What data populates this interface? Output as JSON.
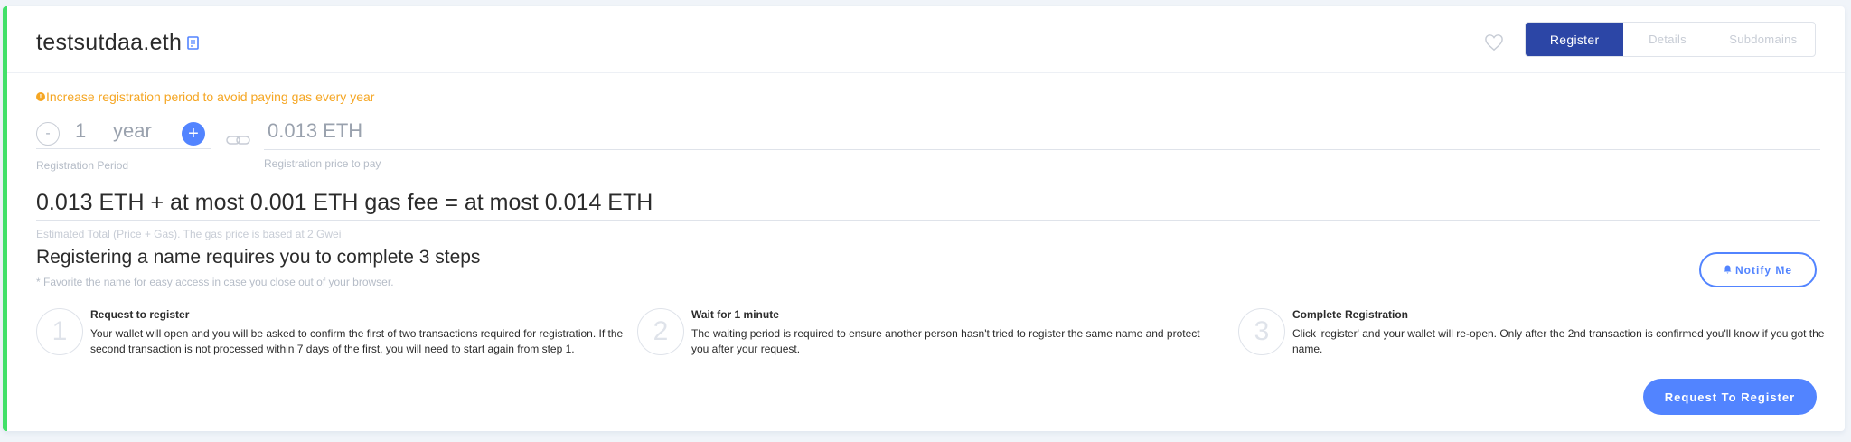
{
  "header": {
    "domain_name": "testsutdaa.eth",
    "tabs": [
      {
        "label": "Register",
        "active": true
      },
      {
        "label": "Details",
        "active": false
      },
      {
        "label": "Subdomains",
        "active": false
      }
    ],
    "icons": {
      "copy": "copy-icon",
      "favorite": "heart-icon"
    }
  },
  "registration": {
    "warning": "Increase registration period to avoid paying gas every year",
    "minus_label": "-",
    "years": "1",
    "year_unit": "year",
    "plus_label": "+",
    "period_label": "Registration Period",
    "price": "0.013 ETH",
    "price_label": "Registration price to pay",
    "total": "0.013 ETH + at most 0.001 ETH gas fee = at most 0.014 ETH",
    "total_label": "Estimated Total (Price + Gas). The gas price is based at 2 Gwei"
  },
  "steps": {
    "title": "Registering a name requires you to complete 3 steps",
    "note": "* Favorite the name for easy access in case you close out of your browser.",
    "notify_label": "Notify Me",
    "items": [
      {
        "number": "1",
        "title": "Request to register",
        "text": "Your wallet will open and you will be asked to confirm the first of two transactions required for registration. If the second transaction is not processed within 7 days of the first, you will need to start again from step 1."
      },
      {
        "number": "2",
        "title": "Wait for 1 minute",
        "text": "The waiting period is required to ensure another person hasn't tried to register the same name and protect you after your request."
      },
      {
        "number": "3",
        "title": "Complete Registration",
        "text": "Click 'register' and your wallet will re-open. Only after the 2nd transaction is confirmed you'll know if you got the name."
      }
    ]
  },
  "actions": {
    "request_label": "Request To Register"
  },
  "colors": {
    "accent": "#5284ff",
    "active_tab": "#2c46a6",
    "warning": "#f5a623",
    "status_bar": "#42e068"
  }
}
